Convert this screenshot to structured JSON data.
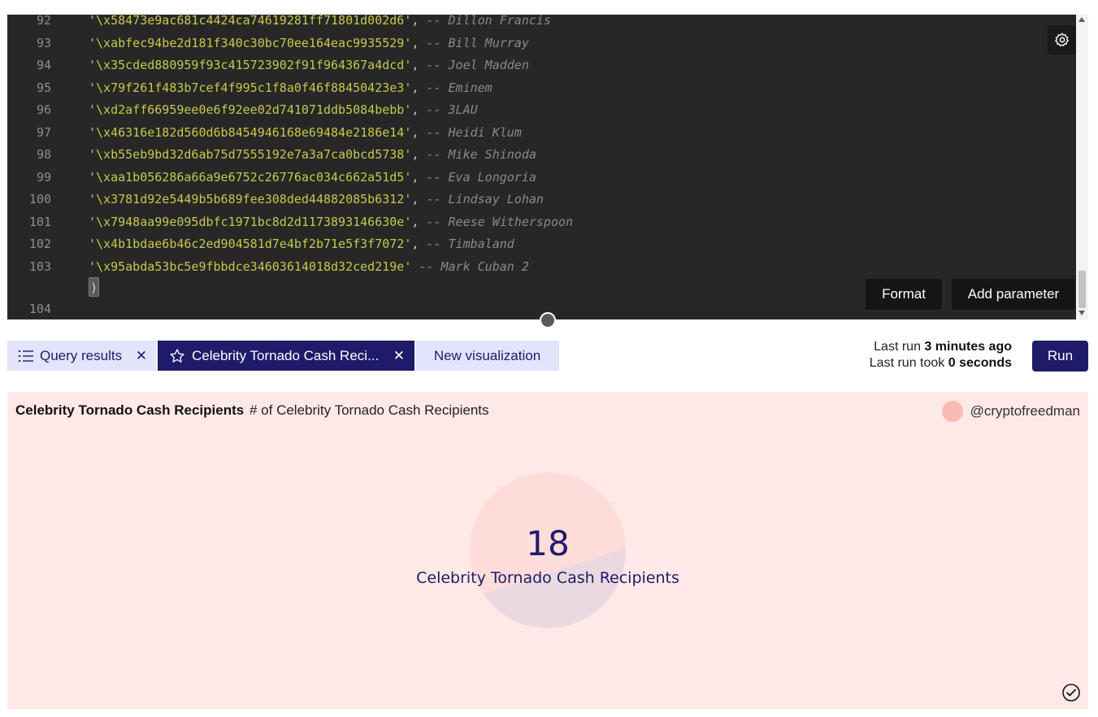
{
  "editor": {
    "lines": [
      {
        "no": "92",
        "str": "'\\x58473e9ac681c4424ca74619281ff71801d002d6'",
        "punc": ",",
        "comment": "-- Dillon Francis"
      },
      {
        "no": "93",
        "str": "'\\xabfec94be2d181f340c30bc70ee164eac9935529'",
        "punc": ",",
        "comment": "-- Bill Murray"
      },
      {
        "no": "94",
        "str": "'\\x35cded880959f93c415723902f91f964367a4dcd'",
        "punc": ",",
        "comment": "-- Joel Madden"
      },
      {
        "no": "95",
        "str": "'\\x79f261f483b7cef4f995c1f8a0f46f88450423e3'",
        "punc": ",",
        "comment": "-- Eminem"
      },
      {
        "no": "96",
        "str": "'\\xd2aff66959ee0e6f92ee02d741071ddb5084bebb'",
        "punc": ",",
        "comment": "-- 3LAU"
      },
      {
        "no": "97",
        "str": "'\\x46316e182d560d6b8454946168e69484e2186e14'",
        "punc": ",",
        "comment": "-- Heidi Klum"
      },
      {
        "no": "98",
        "str": "'\\xb55eb9bd32d6ab75d7555192e7a3a7ca0bcd5738'",
        "punc": ",",
        "comment": "-- Mike Shinoda"
      },
      {
        "no": "99",
        "str": "'\\xaa1b056286a66a9e6752c26776ac034c662a51d5'",
        "punc": ",",
        "comment": "-- Eva Longoria"
      },
      {
        "no": "100",
        "str": "'\\x3781d92e5449b5b689fee308ded44882085b6312'",
        "punc": ",",
        "comment": "-- Lindsay Lohan"
      },
      {
        "no": "101",
        "str": "'\\x7948aa99e095dbfc1971bc8d2d1173893146630e'",
        "punc": ",",
        "comment": "-- Reese Witherspoon"
      },
      {
        "no": "102",
        "str": "'\\x4b1bdae6b46c2ed904581d7e4bf2b71e5f3f7072'",
        "punc": ",",
        "comment": "-- Timbaland"
      },
      {
        "no": "103",
        "str": "'\\x95abda53bc5e9fbbdce34603614018d32ced219e'",
        "punc": "",
        "comment": "-- Mark Cuban 2"
      }
    ],
    "last_line_no": "104",
    "last_line_text": ")",
    "format_label": "Format",
    "add_parameter_label": "Add parameter",
    "settings_icon": "gear-icon"
  },
  "tabs": {
    "query_results_label": "Query results",
    "viz_tab_label": "Celebrity Tornado Cash Reci...",
    "new_viz_label": "New visualization"
  },
  "run_info": {
    "last_run_prefix": "Last run",
    "last_run_value": "3 minutes ago",
    "last_run_took_prefix": "Last run took",
    "last_run_took_value": "0 seconds",
    "run_label": "Run"
  },
  "viz": {
    "title": "Celebrity Tornado Cash Recipients",
    "subtitle": "# of Celebrity Tornado Cash Recipients",
    "author": "@cryptofreedman",
    "counter_value": "18",
    "counter_label": "Celebrity Tornado Cash Recipients"
  },
  "colors": {
    "editor_bg": "#272727",
    "string": "#c6c94c",
    "comment": "#8a8a8a",
    "accent": "#1e1b6b",
    "tab_light": "#e3e3fb",
    "viz_bg": "#fee9e7",
    "avatar": "#fbbab3"
  }
}
